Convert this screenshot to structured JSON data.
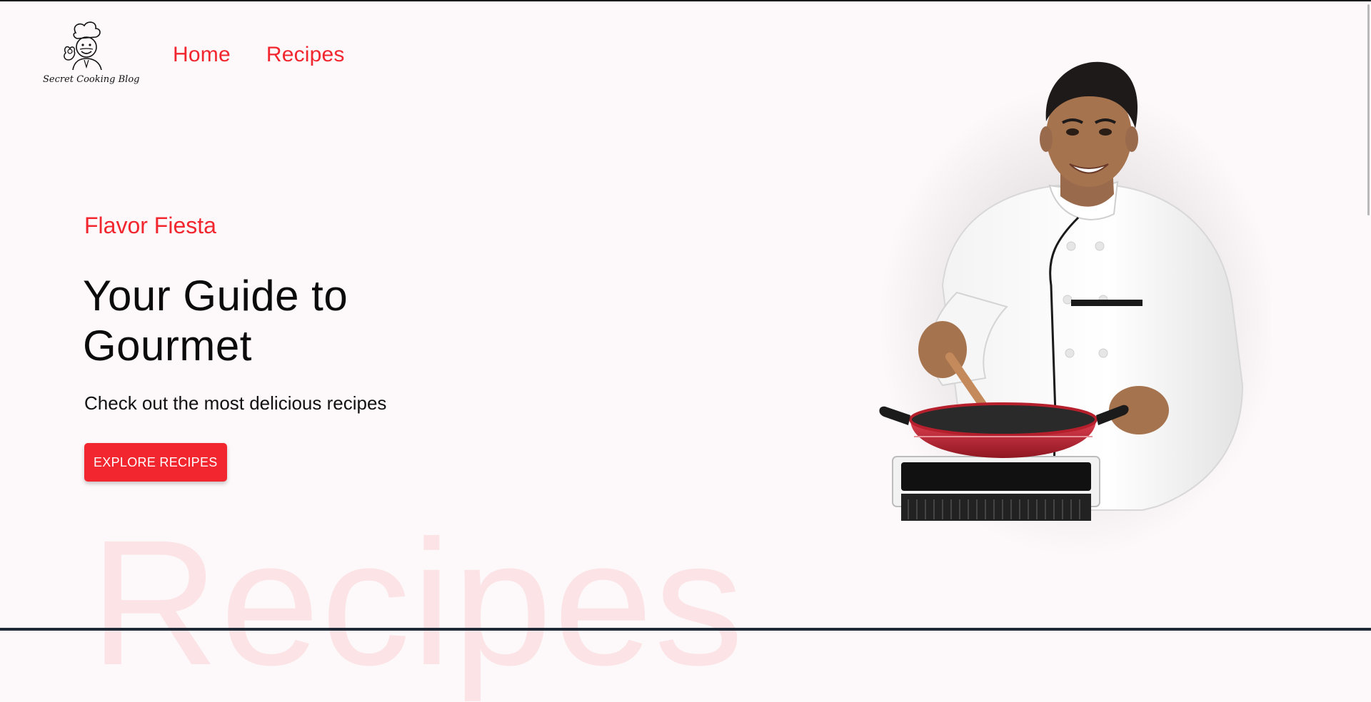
{
  "brand": {
    "logo_text": "Secret Cooking Blog"
  },
  "nav": {
    "items": [
      {
        "label": "Home"
      },
      {
        "label": "Recipes"
      }
    ]
  },
  "hero": {
    "eyebrow": "Flavor Fiesta",
    "headline": "Your Guide to Gourmet",
    "subline": "Check out the most delicious recipes",
    "cta_label": "EXPLORE RECIPES"
  },
  "watermark": "Recipes",
  "colors": {
    "accent": "#f2262e",
    "background": "#fdf8f9",
    "watermark": "#fbe3e6"
  }
}
